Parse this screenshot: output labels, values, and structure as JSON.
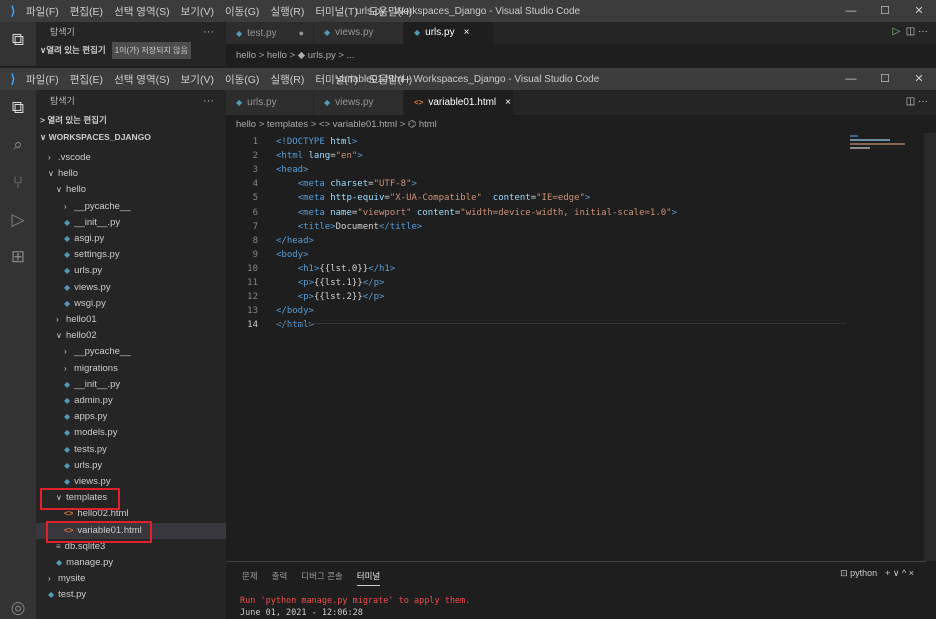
{
  "back_window": {
    "title": "urls.py - Workspaces_Django - Visual Studio Code",
    "menu": [
      "파일(F)",
      "편집(E)",
      "선택 영역(S)",
      "보기(V)",
      "이동(G)",
      "실행(R)",
      "터미널(T)",
      "도움말(H)"
    ],
    "explorer_label": "탐색기",
    "open_editors": "열려 있는 편집기",
    "unsaved_badge": "1이(가) 저장되지 않음",
    "tabs": [
      {
        "label": "test.py",
        "state": "●"
      },
      {
        "label": "views.py",
        "state": ""
      },
      {
        "label": "urls.py",
        "state": "×"
      }
    ],
    "breadcrumb": "hello > hello > ◆ urls.py > ..."
  },
  "front_window": {
    "title": "variable01.html - Workspaces_Django - Visual Studio Code",
    "menu": [
      "파일(F)",
      "편집(E)",
      "선택 영역(S)",
      "보기(V)",
      "이동(G)",
      "실행(R)",
      "터미널(T)",
      "도움말(H)"
    ],
    "explorer_label": "탐색기",
    "open_editors": "> 열려 있는 편집기",
    "workspace": "WORKSPACES_DJANGO",
    "tabs": [
      {
        "label": "urls.py",
        "state": ""
      },
      {
        "label": "views.py",
        "state": ""
      },
      {
        "label": "variable01.html",
        "state": "×"
      }
    ],
    "breadcrumb": "hello > templates > <> variable01.html > ⌬ html"
  },
  "tree": [
    {
      "label": ".vscode",
      "type": "folder-closed",
      "indent": 1
    },
    {
      "label": "hello",
      "type": "folder-open",
      "indent": 1
    },
    {
      "label": "hello",
      "type": "folder-open",
      "indent": 2
    },
    {
      "label": "__pycache__",
      "type": "folder-closed",
      "indent": 3
    },
    {
      "label": "__init__.py",
      "type": "py",
      "indent": 3
    },
    {
      "label": "asgi.py",
      "type": "py",
      "indent": 3
    },
    {
      "label": "settings.py",
      "type": "py",
      "indent": 3
    },
    {
      "label": "urls.py",
      "type": "py",
      "indent": 3
    },
    {
      "label": "views.py",
      "type": "py",
      "indent": 3
    },
    {
      "label": "wsgi.py",
      "type": "py",
      "indent": 3
    },
    {
      "label": "hello01",
      "type": "folder-closed",
      "indent": 2
    },
    {
      "label": "hello02",
      "type": "folder-open",
      "indent": 2
    },
    {
      "label": "__pycache__",
      "type": "folder-closed",
      "indent": 3
    },
    {
      "label": "migrations",
      "type": "folder-closed",
      "indent": 3
    },
    {
      "label": "__init__.py",
      "type": "py",
      "indent": 3
    },
    {
      "label": "admin.py",
      "type": "py",
      "indent": 3
    },
    {
      "label": "apps.py",
      "type": "py",
      "indent": 3
    },
    {
      "label": "models.py",
      "type": "py",
      "indent": 3
    },
    {
      "label": "tests.py",
      "type": "py",
      "indent": 3
    },
    {
      "label": "urls.py",
      "type": "py",
      "indent": 3
    },
    {
      "label": "views.py",
      "type": "py",
      "indent": 3
    },
    {
      "label": "templates",
      "type": "folder-open",
      "indent": 2
    },
    {
      "label": "hello02.html",
      "type": "html",
      "indent": 3
    },
    {
      "label": "variable01.html",
      "type": "html",
      "indent": 3,
      "selected": true
    },
    {
      "label": "db.sqlite3",
      "type": "db",
      "indent": 2
    },
    {
      "label": "manage.py",
      "type": "py",
      "indent": 2
    },
    {
      "label": "mysite",
      "type": "folder-closed",
      "indent": 1
    },
    {
      "label": "test.py",
      "type": "py",
      "indent": 1
    }
  ],
  "code_lines": [
    [
      [
        "tg",
        "<!DOCTYPE "
      ],
      [
        "at",
        "html"
      ],
      [
        "tg",
        ">"
      ]
    ],
    [
      [
        "tg",
        "<html "
      ],
      [
        "at",
        "lang"
      ],
      [
        "",
        "="
      ],
      [
        "st",
        "\"en\""
      ],
      [
        "tg",
        ">"
      ]
    ],
    [
      [
        "tg",
        "<head>"
      ]
    ],
    [
      [
        "",
        "    "
      ],
      [
        "tg",
        "<meta "
      ],
      [
        "at",
        "charset"
      ],
      [
        "",
        "="
      ],
      [
        "st",
        "\"UTF-8\""
      ],
      [
        "tg",
        ">"
      ]
    ],
    [
      [
        "",
        "    "
      ],
      [
        "tg",
        "<meta "
      ],
      [
        "at",
        "http-equiv"
      ],
      [
        "",
        "="
      ],
      [
        "st",
        "\"X-UA-Compatible\""
      ],
      [
        "",
        "  "
      ],
      [
        "at",
        "content"
      ],
      [
        "",
        "="
      ],
      [
        "st",
        "\"IE=edge\""
      ],
      [
        "tg",
        ">"
      ]
    ],
    [
      [
        "",
        "    "
      ],
      [
        "tg",
        "<meta "
      ],
      [
        "at",
        "name"
      ],
      [
        "",
        "="
      ],
      [
        "st",
        "\"viewport\""
      ],
      [
        "",
        " "
      ],
      [
        "at",
        "content"
      ],
      [
        "",
        "="
      ],
      [
        "st",
        "\"width=device-width, initial-scale=1.0\""
      ],
      [
        "tg",
        ">"
      ]
    ],
    [
      [
        "",
        "    "
      ],
      [
        "tg",
        "<title>"
      ],
      [
        "",
        "Document"
      ],
      [
        "tg",
        "</title>"
      ]
    ],
    [
      [
        "tg",
        "</head>"
      ]
    ],
    [
      [
        "tg",
        "<body>"
      ]
    ],
    [
      [
        "",
        "    "
      ],
      [
        "tg",
        "<h1>"
      ],
      [
        "",
        "{{lst.0}}"
      ],
      [
        "tg",
        "</h1>"
      ]
    ],
    [
      [
        "",
        "    "
      ],
      [
        "tg",
        "<p>"
      ],
      [
        "",
        "{{lst.1}}"
      ],
      [
        "tg",
        "</p>"
      ]
    ],
    [
      [
        "",
        "    "
      ],
      [
        "tg",
        "<p>"
      ],
      [
        "",
        "{{lst.2}}"
      ],
      [
        "tg",
        "</p>"
      ]
    ],
    [
      [
        "tg",
        "</body>"
      ]
    ],
    [
      [
        "tg",
        "</html>"
      ]
    ]
  ],
  "panel": {
    "tabs": [
      "문제",
      "출력",
      "디버그 콘솔",
      "터미널"
    ],
    "active_tab": "터미널",
    "shell": "python",
    "controls": "+ ∨  ^  ×",
    "terminal_line1": "Run 'python manage.py migrate' to apply them.",
    "terminal_line2": "June 01, 2021 - 12:06:28"
  },
  "colors": {
    "accent": "#3ea6ff",
    "highlight": "#e0202a"
  }
}
